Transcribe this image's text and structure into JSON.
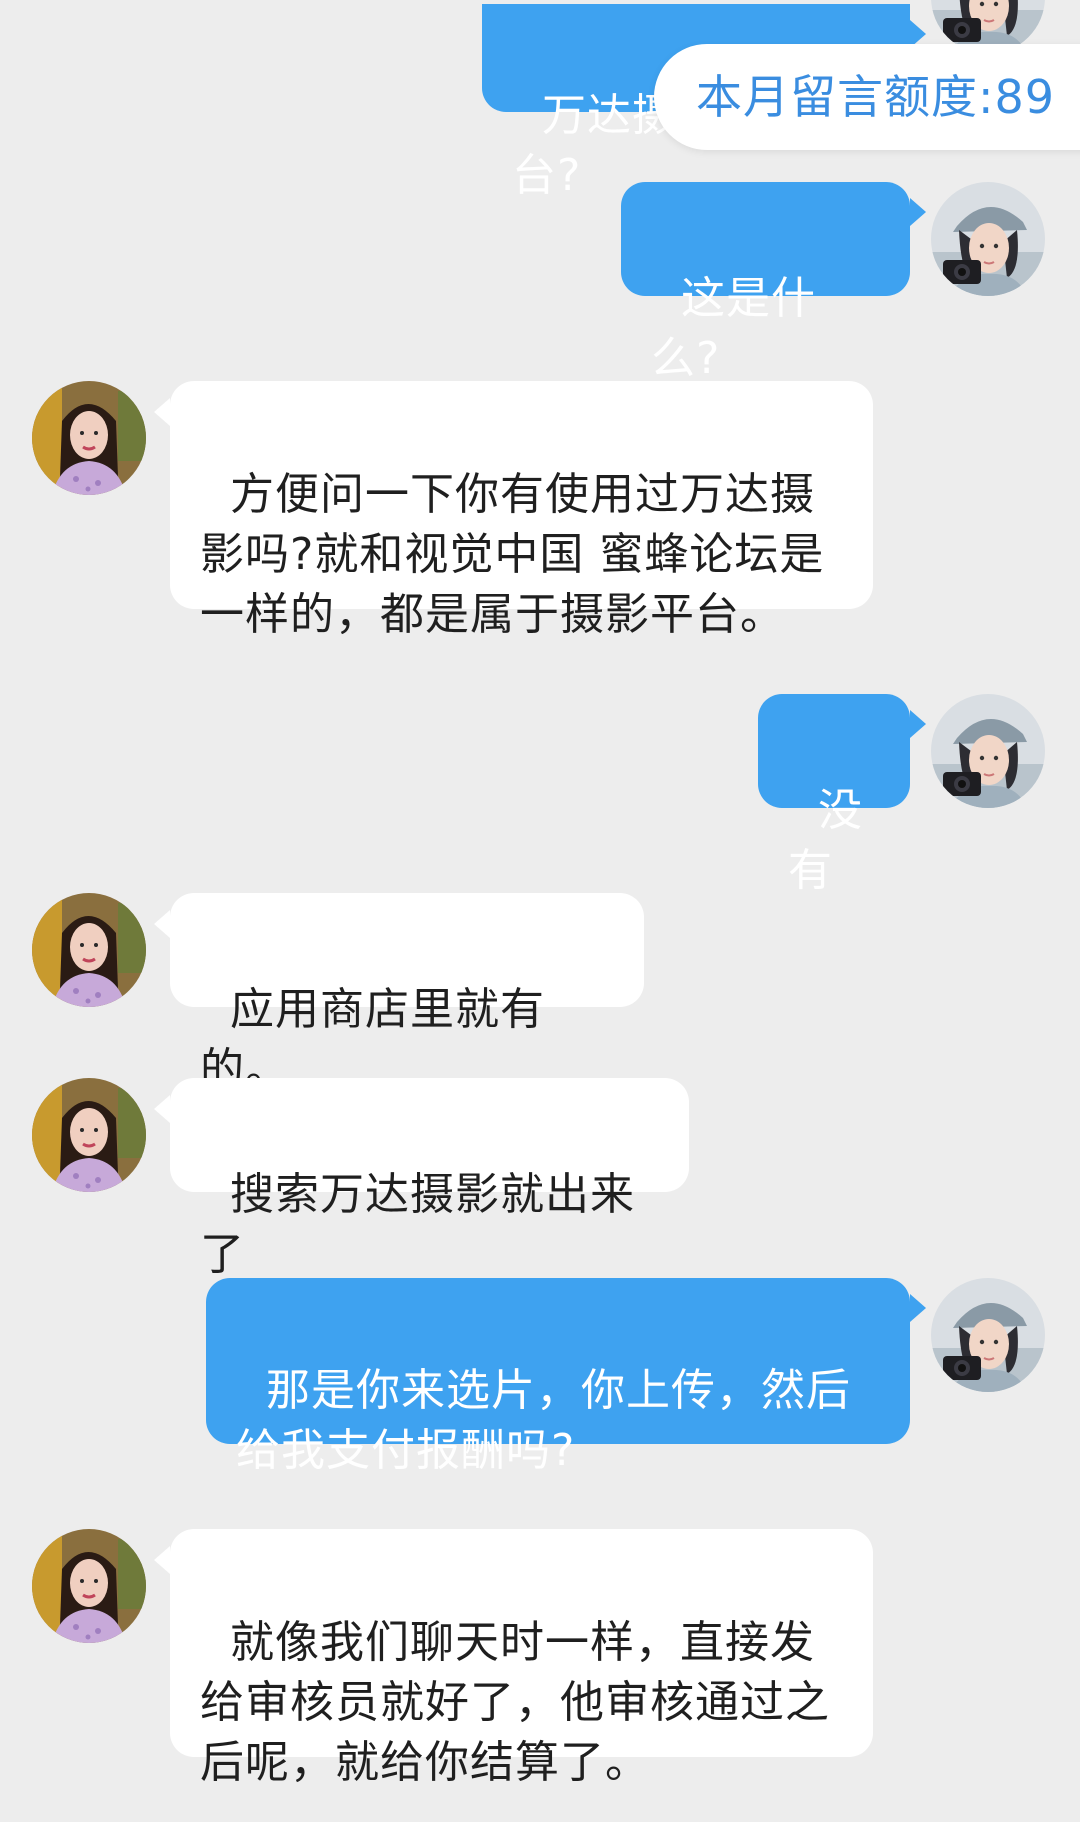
{
  "quota": {
    "label": "本月留言额度:89"
  },
  "colors": {
    "background": "#ededed",
    "me_bubble": "#3ea2f0",
    "them_bubble": "#ffffff",
    "quota_text": "#3a8de0"
  },
  "messages": [
    {
      "sender": "me",
      "text": "万达摄影审核台?"
    },
    {
      "sender": "me",
      "text": "这是什么?"
    },
    {
      "sender": "them",
      "text": "方便问一下你有使用过万达摄影吗?就和视觉中国 蜜蜂论坛是一样的，都是属于摄影平台。"
    },
    {
      "sender": "me",
      "text": "没有"
    },
    {
      "sender": "them",
      "text": "应用商店里就有的。"
    },
    {
      "sender": "them",
      "text": "搜索万达摄影就出来了"
    },
    {
      "sender": "me",
      "text": "那是你来选片，你上传，然后给我支付报酬吗?"
    },
    {
      "sender": "them",
      "text": "就像我们聊天时一样，直接发给审核员就好了，他审核通过之后呢，就给你结算了。"
    }
  ]
}
